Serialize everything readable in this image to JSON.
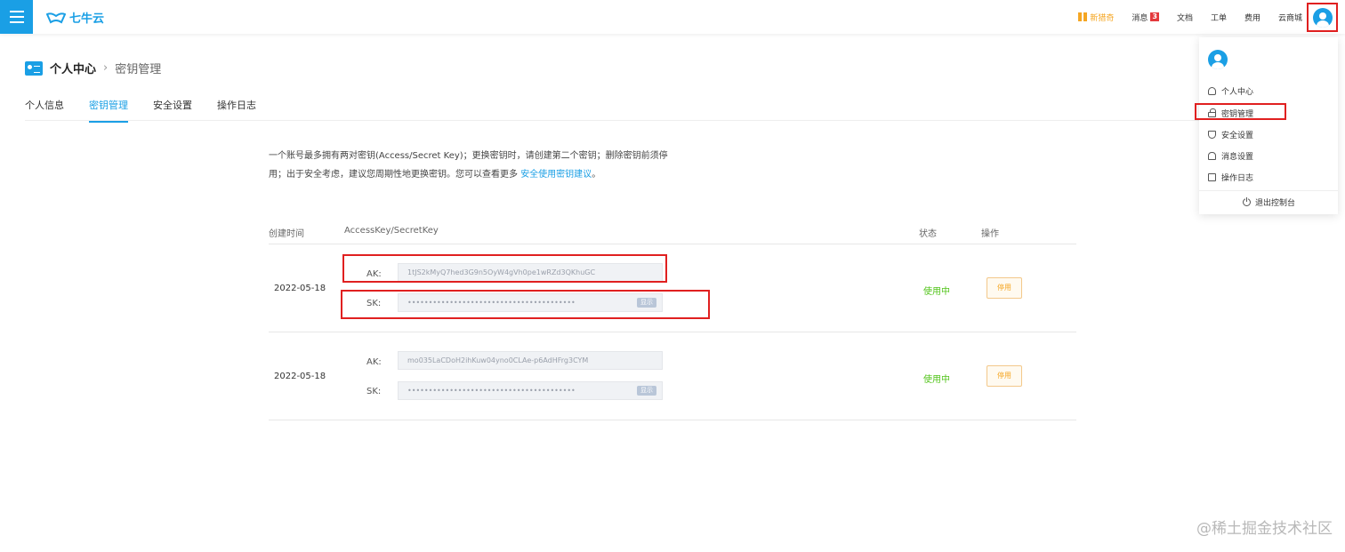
{
  "brand": {
    "name": "七牛云",
    "color": "#1a9fe5"
  },
  "topnav": {
    "new_label": "新猎奇",
    "messages_label": "消息",
    "messages_count": "3",
    "docs_label": "文档",
    "ticket_label": "工单",
    "billing_label": "费用",
    "market_label": "云商城"
  },
  "breadcrumb": {
    "main": "个人中心",
    "sep": "›",
    "sub": "密钥管理"
  },
  "tabs": [
    {
      "label": "个人信息",
      "active": false
    },
    {
      "label": "密钥管理",
      "active": true
    },
    {
      "label": "安全设置",
      "active": false
    },
    {
      "label": "操作日志",
      "active": false
    }
  ],
  "description": {
    "line1": "一个账号最多拥有两对密钥(Access/Secret Key)；更换密钥时，请创建第二个密钥；删除密钥前须停",
    "line2_prefix": "用；出于安全考虑，建议您周期性地更换密钥。您可以查看更多 ",
    "link": "安全使用密钥建议",
    "line2_suffix": "。"
  },
  "table": {
    "headers": {
      "created": "创建时间",
      "keys": "AccessKey/SecretKey",
      "status": "状态",
      "actions": "操作"
    },
    "rows": [
      {
        "date": "2022-05-18",
        "ak_label": "AK:",
        "ak": "1tJS2kMyQ7hed3G9n5OyW4gVh0pe1wRZd3QKhuGC",
        "sk_label": "SK:",
        "sk": "••••••••••••••••••••••••••••••••••••••••",
        "show_label": "显示",
        "status": "使用中",
        "action": "停用"
      },
      {
        "date": "2022-05-18",
        "ak_label": "AK:",
        "ak": "mo035LaCDoH2ihKuw04yno0CLAe-p6AdHFrg3CYM",
        "sk_label": "SK:",
        "sk": "••••••••••••••••••••••••••••••••••••••••",
        "show_label": "显示",
        "status": "使用中",
        "action": "停用"
      }
    ]
  },
  "dropdown": {
    "items": [
      {
        "label": "个人中心",
        "icon": "user-icon"
      },
      {
        "label": "密钥管理",
        "icon": "lock-icon"
      },
      {
        "label": "安全设置",
        "icon": "shield-icon"
      },
      {
        "label": "消息设置",
        "icon": "bell-icon"
      },
      {
        "label": "操作日志",
        "icon": "log-icon"
      }
    ],
    "logout": "退出控制台"
  },
  "watermark": "@稀土掘金技术社区"
}
